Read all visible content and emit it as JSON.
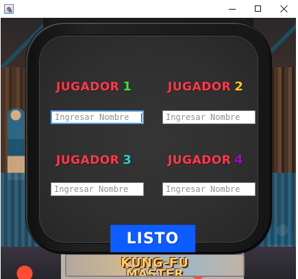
{
  "window": {
    "title": "",
    "controls": {
      "minimize_icon": "minimize-icon",
      "maximize_icon": "maximize-icon",
      "close_icon": "close-icon"
    }
  },
  "background": {
    "marquee_line_1": "KUNG-FU",
    "marquee_line_2": "MASTER"
  },
  "players": [
    {
      "label": "JUGADOR",
      "number": "1",
      "number_color": "#40e044",
      "name_value": "",
      "placeholder": "Ingresar Nombre",
      "focused": true
    },
    {
      "label": "JUGADOR",
      "number": "2",
      "number_color": "#ffcb1f",
      "name_value": "",
      "placeholder": "Ingresar Nombre",
      "focused": false
    },
    {
      "label": "JUGADOR",
      "number": "3",
      "number_color": "#1ed6c8",
      "name_value": "",
      "placeholder": "Ingresar Nombre",
      "focused": false
    },
    {
      "label": "JUGADOR",
      "number": "4",
      "number_color": "#b100ce",
      "name_value": "",
      "placeholder": "Ingresar Nombre",
      "focused": false
    }
  ],
  "actions": {
    "ready_label": "LISTO"
  },
  "colors": {
    "player_label": "#ff384a",
    "ready_button": "#0c5cff",
    "screen": "#303030",
    "focused_input_border": "#5e9ee6"
  }
}
